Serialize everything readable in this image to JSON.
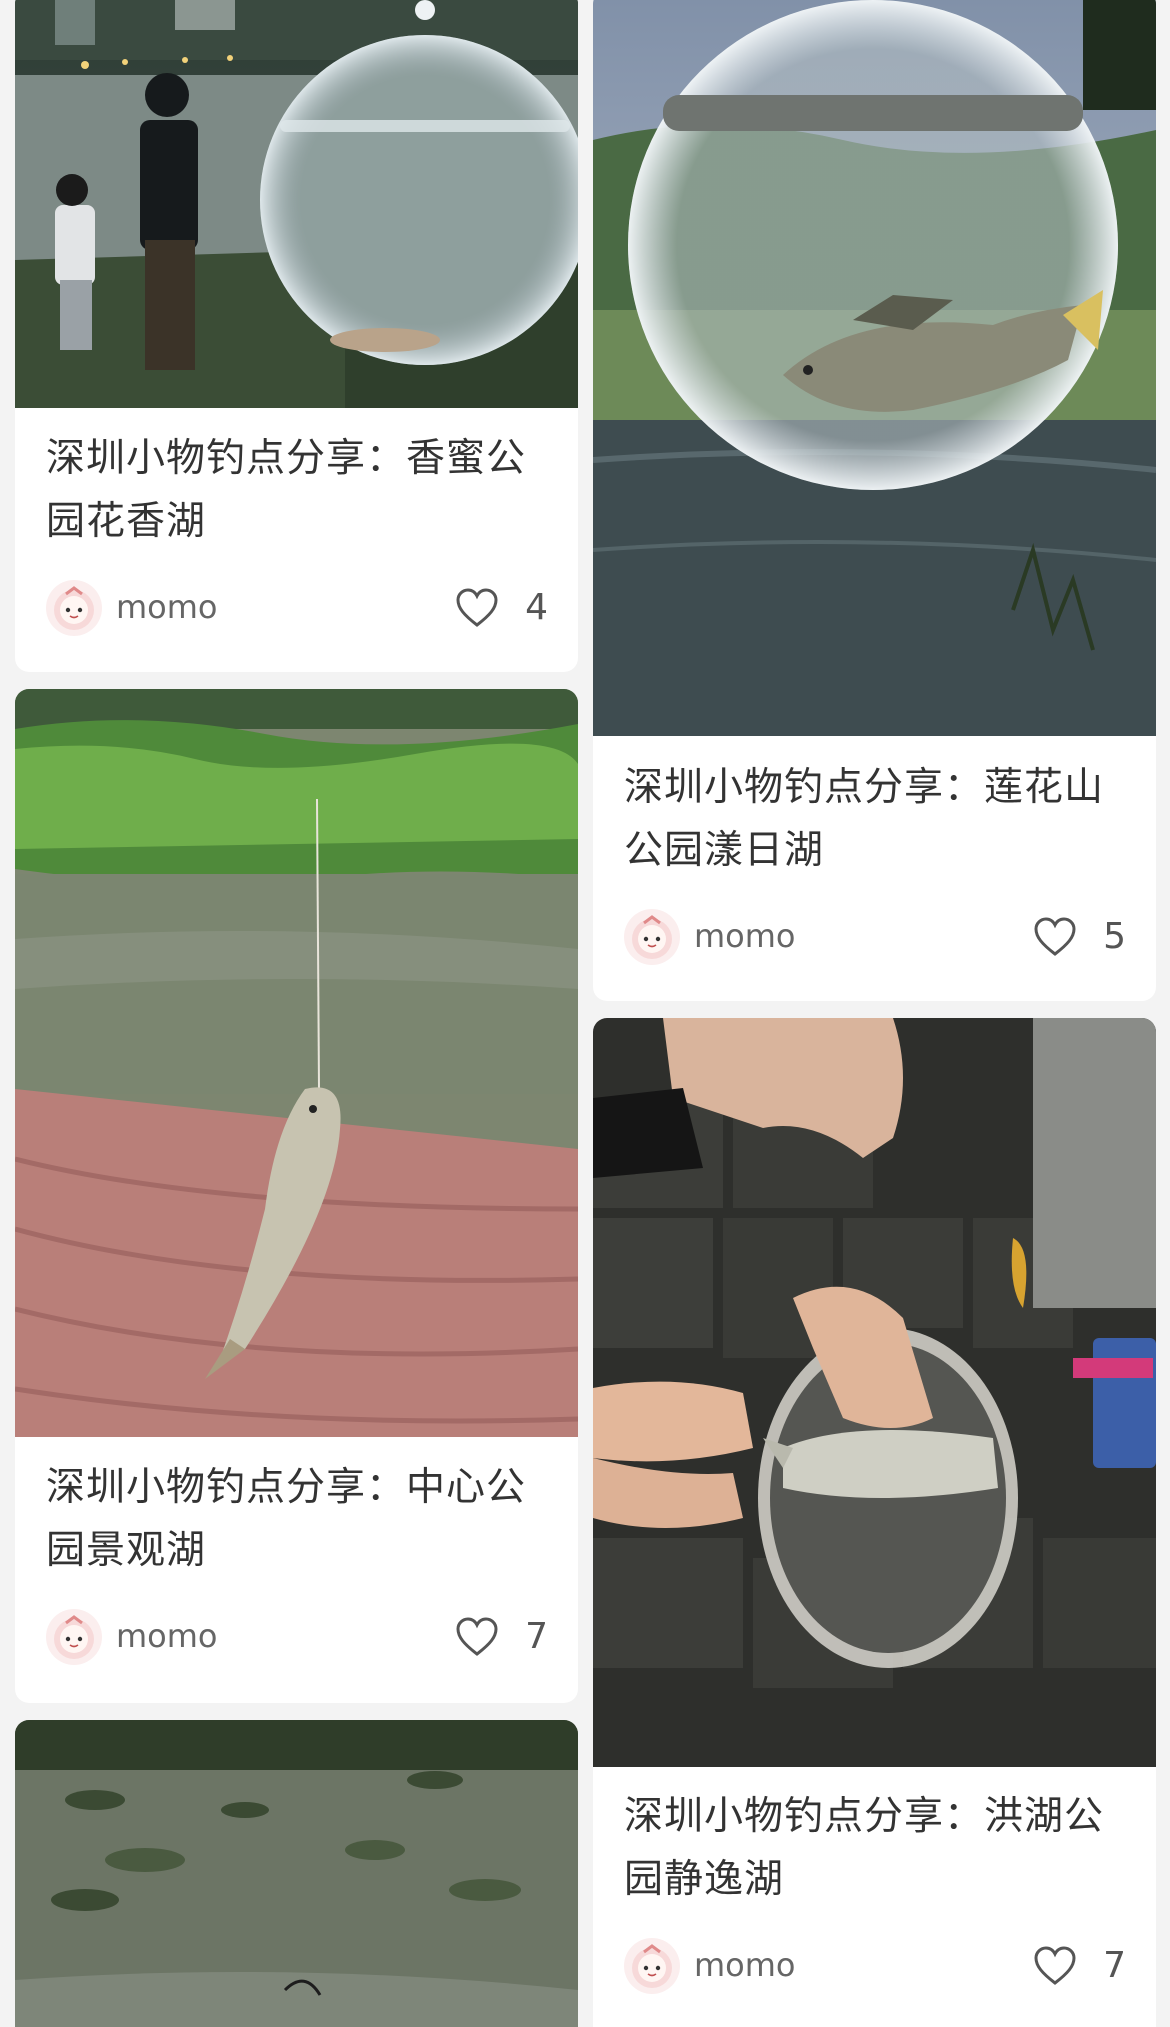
{
  "feed": {
    "left_column": [
      {
        "title": "深圳小物钓点分享：香蜜公园花香湖",
        "author": "momo",
        "likes": "4",
        "image": "night lake with round fish viewing bottle"
      },
      {
        "title": "深圳小物钓点分享：中心公园景观湖",
        "author": "momo",
        "likes": "7",
        "image": "small fish on hook over pink wooden deck"
      },
      {
        "title": "",
        "author": "",
        "likes": "",
        "image": "pond with lily pads"
      }
    ],
    "right_column": [
      {
        "title": "深圳小物钓点分享：莲花山公园漾日湖",
        "author": "momo",
        "likes": "5",
        "image": "round fish viewing bottle with tilapia over lake"
      },
      {
        "title": "深圳小物钓点分享：洪湖公园静逸湖",
        "author": "momo",
        "likes": "7",
        "image": "hand holding fish in bucket on stone pavement"
      }
    ]
  },
  "icons": {
    "like": "heart-outline-icon",
    "avatar": "cartoon-avatar-icon"
  },
  "colors": {
    "background": "#f3f3f3",
    "card": "#ffffff",
    "title_text": "#333333",
    "meta_text": "#666666"
  }
}
